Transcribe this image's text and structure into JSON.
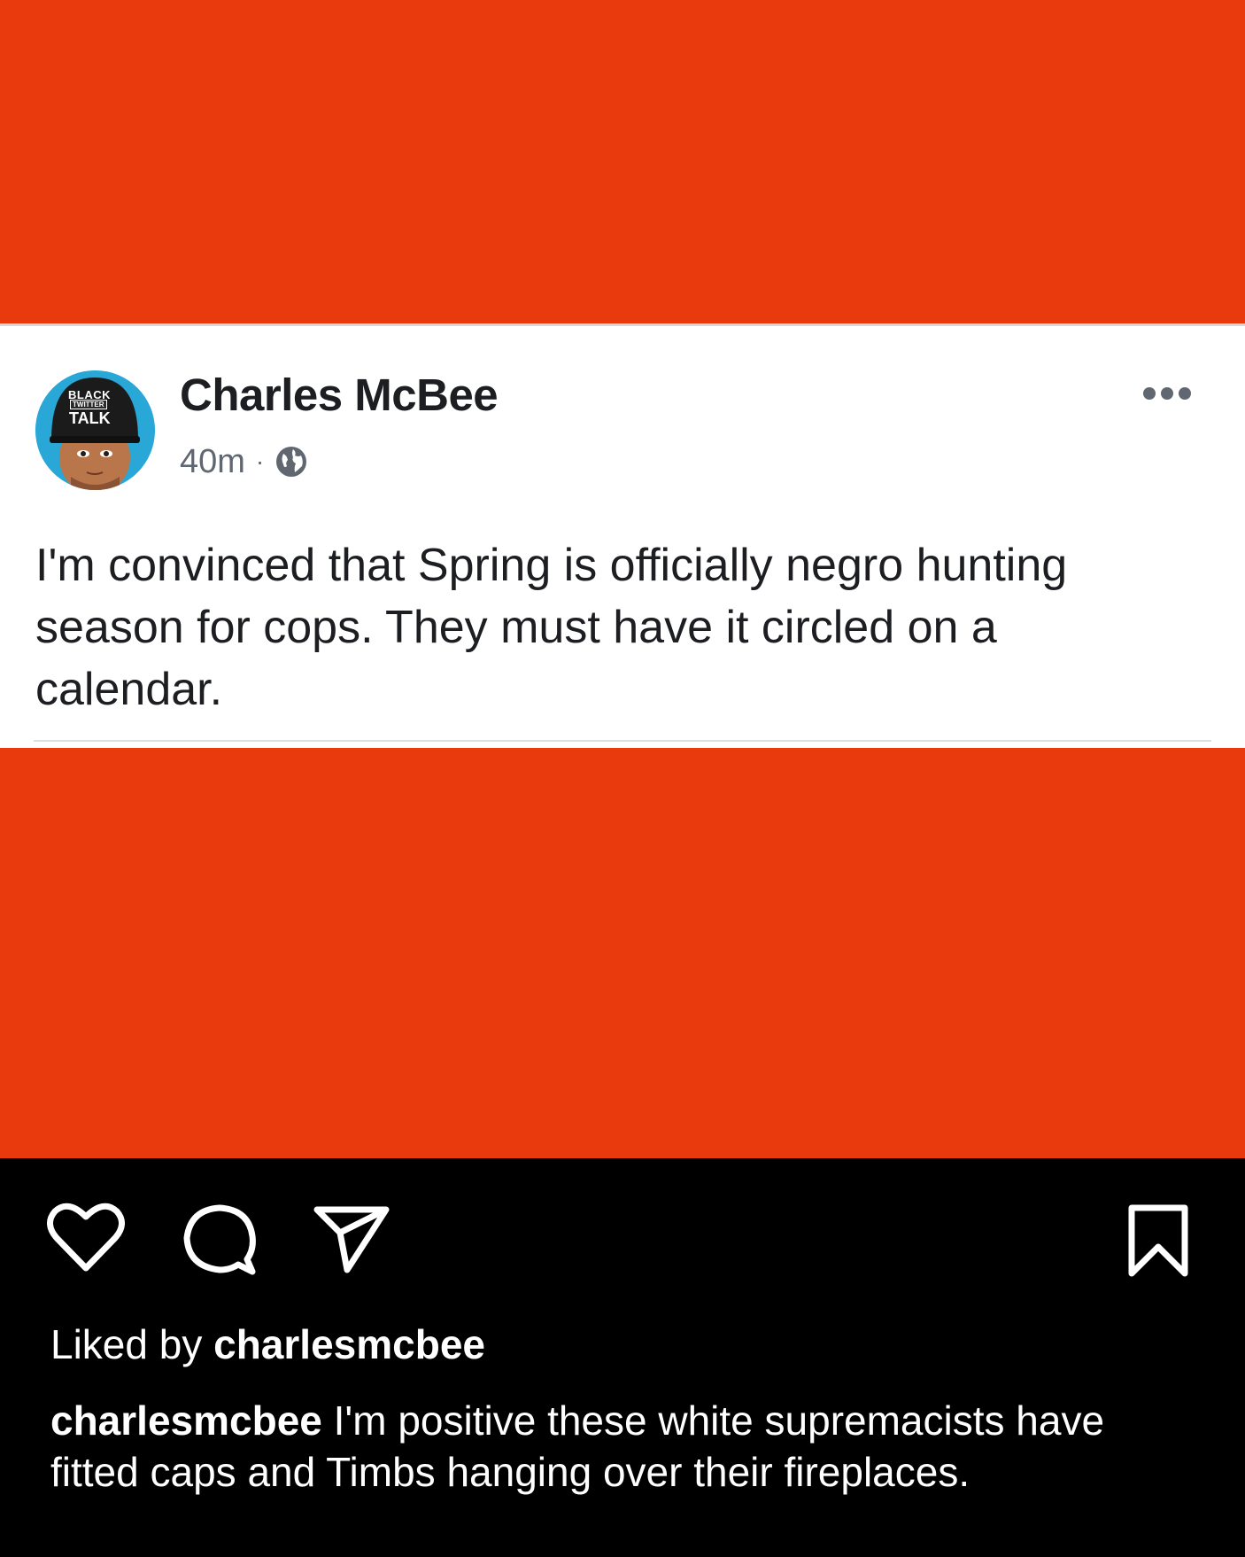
{
  "post": {
    "author": "Charles McBee",
    "time": "40m",
    "separator": "·",
    "privacy_icon": "globe-icon",
    "more_icon": "more-dots-icon",
    "text": "I'm convinced that Spring is officially negro hunting season for cops. They must have it circled on a calendar.",
    "avatar": {
      "cap_text_line1": "BLACK",
      "cap_text_line2": "TWITTER",
      "cap_text_line3": "TALK"
    }
  },
  "instagram": {
    "actions": [
      "heart-icon",
      "comment-icon",
      "share-icon",
      "bookmark-icon"
    ],
    "liked_by_prefix": "Liked by ",
    "liked_by_user": "charlesmcbee",
    "caption_user": "charlesmcbee",
    "caption_text": " I'm positive these white supremacists have fitted caps and Timbs hanging over their fireplaces."
  },
  "colors": {
    "background_orange": "#e93a0d",
    "card_white": "#ffffff",
    "footer_black": "#000000"
  }
}
